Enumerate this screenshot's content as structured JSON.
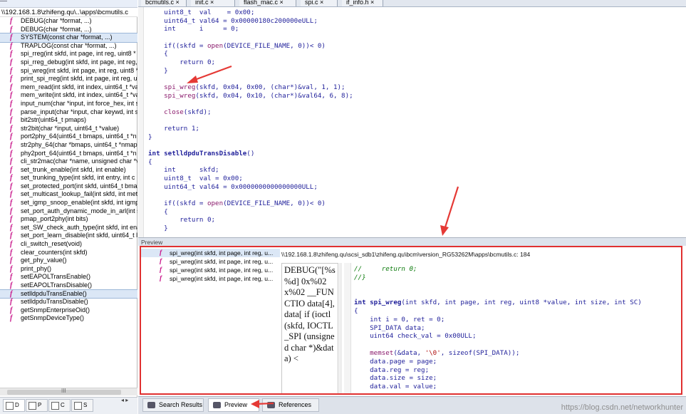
{
  "left_panel": {
    "path": "\\\\192.168.1.8\\zhifeng.qu\\..\\apps\\bcmutils.c",
    "functions": [
      "DEBUG(char *format, ...)",
      "DEBUG(char *format, ...)",
      "SYSTEM(const char *format, ...)",
      "TRAPLOG(const char *format, ...)",
      "spi_rreg(int skfd, int page, int reg, uint8 *",
      "spi_rreg_debug(int skfd, int page, int reg,",
      "spi_wreg(int skfd, int page, int reg, uint8 *",
      "print_spi_rreg(int skfd, int page, int reg, u",
      "mem_read(int skfd, int index, uint64_t *va",
      "mem_write(int skfd, int index, uint64_t *va",
      "input_num(char *input, int force_hex, int s",
      "parse_input(char *input, char keywd, int s",
      "bit2str(uint64_t pmaps)",
      "str2bit(char *input, uint64_t *value)",
      "port2phy_64(uint64_t bmaps, uint64_t *n",
      "str2phy_64(char *bmaps, uint64_t *nmap",
      "phy2port_64(uint64_t bmaps, uint64_t *n",
      "cli_str2mac(char *name, unsigned char *va",
      "set_trunk_enable(int skfd, int enable)",
      "set_trunking_type(int skfd, int entry, int c",
      "set_protected_port(int skfd, uint64_t bma",
      "set_multicast_lookup_fail(int skfd, int meth",
      "set_igmp_snoop_enable(int skfd, int igmp_",
      "set_port_auth_dynamic_mode_in_arl(int sl",
      "pmap_port2phy(int bits)",
      "set_SW_check_auth_type(int skfd, int ena",
      "set_port_learn_disable(int skfd, uint64_t l",
      "cli_switch_reset(void)",
      "clear_counters(int skfd)",
      "get_phy_value()",
      "print_phy()",
      "setEAPOLTransEnable()",
      "setEAPOLTransDisable()",
      "setlldpduTransEnable()",
      "setlldpduTransDisable()",
      "getSnmpEnterpriseOid()",
      "getSnmpDeviceType()"
    ],
    "scroll_label": "III",
    "tabs": [
      {
        "label": "D",
        "icon": "symbol-window-icon"
      },
      {
        "label": "P",
        "icon": "project-window-icon"
      },
      {
        "label": "C",
        "icon": "class-window-icon"
      },
      {
        "label": "S",
        "icon": "symbol-search-icon"
      }
    ]
  },
  "editor": {
    "tabs": [
      "bcmutils.c",
      "init.c",
      "flash_mac.c",
      "spi.c",
      "if_info.h"
    ],
    "lines": [
      [
        {
          "t": "    uint8_t  val    = 0x00;",
          "c": "code"
        }
      ],
      [
        {
          "t": "    uint64_t val64 = 0x00000180c200000eULL;",
          "c": "code"
        }
      ],
      [
        {
          "t": "    int      i     = 0;",
          "c": "code"
        }
      ],
      [
        {
          "t": "",
          "c": "code"
        }
      ],
      [
        {
          "t": "    if((skfd = ",
          "c": "code"
        },
        {
          "t": "open",
          "c": "fn"
        },
        {
          "t": "(DEVICE_FILE_NAME, 0))< 0)",
          "c": "code"
        }
      ],
      [
        {
          "t": "    {",
          "c": "code"
        }
      ],
      [
        {
          "t": "        return 0;",
          "c": "code"
        }
      ],
      [
        {
          "t": "    }",
          "c": "code"
        }
      ],
      [
        {
          "t": "",
          "c": "code"
        }
      ],
      [
        {
          "t": "    spi_wreg",
          "c": "fn"
        },
        {
          "t": "(skfd, 0x04, 0x00, (char*)&val, 1, 1);",
          "c": "code"
        }
      ],
      [
        {
          "t": "    spi_wreg",
          "c": "fn"
        },
        {
          "t": "(skfd, 0x04, 0x10, (char*)&val64, 6, 8);",
          "c": "code"
        }
      ],
      [
        {
          "t": "",
          "c": "code"
        }
      ],
      [
        {
          "t": "    close",
          "c": "fn"
        },
        {
          "t": "(skfd);",
          "c": "code"
        }
      ],
      [
        {
          "t": "",
          "c": "code"
        }
      ],
      [
        {
          "t": "    return 1;",
          "c": "code"
        }
      ],
      [
        {
          "t": "}",
          "c": "code"
        }
      ],
      [
        {
          "t": "",
          "c": "code"
        }
      ],
      [
        {
          "t": "int setlldpduTransDisable",
          "c": "fnhead"
        },
        {
          "t": "()",
          "c": "code"
        }
      ],
      [
        {
          "t": "{",
          "c": "code"
        }
      ],
      [
        {
          "t": "    int      skfd;",
          "c": "code"
        }
      ],
      [
        {
          "t": "    uint8_t  val = 0x00;",
          "c": "code"
        }
      ],
      [
        {
          "t": "    uint64_t val64 = 0x0000000000000000ULL;",
          "c": "code"
        }
      ],
      [
        {
          "t": "",
          "c": "code"
        }
      ],
      [
        {
          "t": "    if((skfd = ",
          "c": "code"
        },
        {
          "t": "open",
          "c": "fn"
        },
        {
          "t": "(DEVICE_FILE_NAME, 0))< 0)",
          "c": "code"
        }
      ],
      [
        {
          "t": "    {",
          "c": "code"
        }
      ],
      [
        {
          "t": "        return 0;",
          "c": "code"
        }
      ],
      [
        {
          "t": "    }",
          "c": "code"
        }
      ]
    ]
  },
  "preview": {
    "title": "Preview",
    "references": [
      "spi_wreg(int skfd, int page, int reg, u...",
      "spi_wreg(int skfd, int page, int reg, u...",
      "spi_wreg(int skfd, int page, int reg, u...",
      "spi_wreg(int skfd, int page, int reg, u..."
    ],
    "file_path": "\\\\192.168.1.8\\zhifeng.qu\\scsi_sdb1\\zhifeng.qu\\bcm\\version_RG53262M\\apps\\bcmutils.c: 184",
    "mini_text": "DEBUG(\"[%s %d] 0x%02x%02 __FUNCTIO data[4],data[ if (ioctl(skfd, IOCTL_SPI (unsigned char *)&data) <",
    "lines": [
      [
        {
          "t": "//     return 0;",
          "c": "cm"
        }
      ],
      [
        {
          "t": "//}",
          "c": "cm"
        }
      ],
      [
        {
          "t": "",
          "c": "code"
        }
      ],
      [
        {
          "t": "",
          "c": "code"
        }
      ],
      [
        {
          "t": "int spi_wreg",
          "c": "fnhead"
        },
        {
          "t": "(int skfd, int page, int reg, uint8 *value, int size, int SC)",
          "c": "code"
        }
      ],
      [
        {
          "t": "{",
          "c": "code"
        }
      ],
      [
        {
          "t": "    int i = 0, ret = 0;",
          "c": "code"
        }
      ],
      [
        {
          "t": "    SPI_DATA data;",
          "c": "code"
        }
      ],
      [
        {
          "t": "    uint64 check_val = 0x00ULL;",
          "c": "code"
        }
      ],
      [
        {
          "t": "",
          "c": "code"
        }
      ],
      [
        {
          "t": "    memset",
          "c": "fn"
        },
        {
          "t": "(&data, ",
          "c": "code"
        },
        {
          "t": "'\\0'",
          "c": "str"
        },
        {
          "t": ", sizeof(SPI_DATA));",
          "c": "code"
        }
      ],
      [
        {
          "t": "    data.page = page;",
          "c": "code"
        }
      ],
      [
        {
          "t": "    data.reg = reg;",
          "c": "code"
        }
      ],
      [
        {
          "t": "    data.size = size;",
          "c": "code"
        }
      ],
      [
        {
          "t": "    data.val = value;",
          "c": "code"
        }
      ]
    ]
  },
  "bottom_tabs": [
    {
      "label": "Search Results",
      "icon": "search-results-icon"
    },
    {
      "label": "Preview",
      "icon": "preview-icon"
    },
    {
      "label": "References",
      "icon": "references-icon"
    }
  ],
  "watermark": "https://blog.csdn.net/networkhunter",
  "colors": {
    "highlight_border": "#e03030",
    "arrow": "#e53935",
    "function_icon": "#c8158a"
  }
}
